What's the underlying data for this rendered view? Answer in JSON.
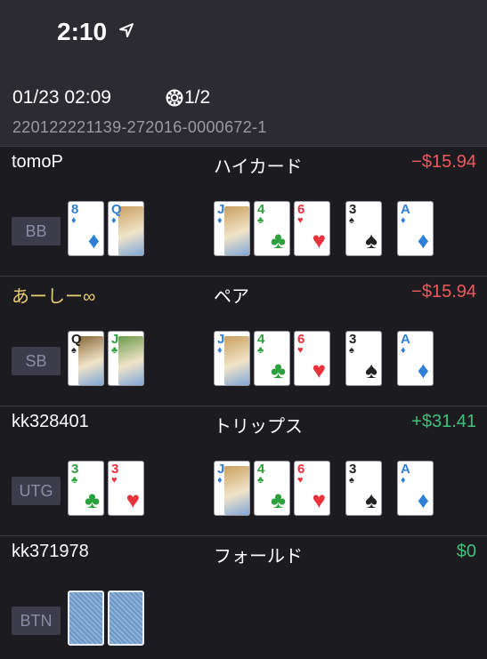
{
  "status_bar": {
    "time": "2:10",
    "location_icon": "location-arrow-icon"
  },
  "header": {
    "date": "01/23 02:09",
    "chip_icon": "poker-chip-icon",
    "hand_count": "1/2",
    "hand_id": "220122221139-272016-0000672-1"
  },
  "board": [
    {
      "rank": "J",
      "suit": "♦",
      "color": "blue",
      "face": true
    },
    {
      "rank": "4",
      "suit": "♣",
      "color": "green",
      "face": false
    },
    {
      "rank": "6",
      "suit": "♥",
      "color": "red",
      "face": false
    },
    {
      "rank": "3",
      "suit": "♠",
      "color": "black",
      "face": false
    },
    {
      "rank": "A",
      "suit": "♦",
      "color": "blue",
      "face": false
    }
  ],
  "players": [
    {
      "name": "tomoP",
      "hero": false,
      "hand_rank": "ハイカード",
      "result": "−$15.94",
      "result_type": "neg",
      "position": "BB",
      "show_board": true,
      "hole": [
        {
          "rank": "8",
          "suit": "♦",
          "color": "blue",
          "face": false
        },
        {
          "rank": "Q",
          "suit": "♦",
          "color": "blue",
          "face": true
        }
      ]
    },
    {
      "name": "あーしー∞",
      "hero": true,
      "hand_rank": "ペア",
      "result": "−$15.94",
      "result_type": "neg",
      "position": "SB",
      "show_board": true,
      "hole": [
        {
          "rank": "Q",
          "suit": "♠",
          "color": "black",
          "face": true
        },
        {
          "rank": "J",
          "suit": "♣",
          "color": "green",
          "face": true
        }
      ]
    },
    {
      "name": "kk328401",
      "hero": false,
      "hand_rank": "トリップス",
      "result": "+$31.41",
      "result_type": "pos",
      "position": "UTG",
      "show_board": true,
      "hole": [
        {
          "rank": "3",
          "suit": "♣",
          "color": "green",
          "face": false
        },
        {
          "rank": "3",
          "suit": "♥",
          "color": "red",
          "face": false
        }
      ]
    },
    {
      "name": "kk371978",
      "hero": false,
      "hand_rank": "フォールド",
      "result": "$0",
      "result_type": "pos",
      "position": "BTN",
      "show_board": false,
      "hole": [
        {
          "back": true
        },
        {
          "back": true
        }
      ]
    }
  ],
  "colors": {
    "negative": "#f0595c",
    "positive": "#3fc17a",
    "hero": "#e9cf6f"
  }
}
